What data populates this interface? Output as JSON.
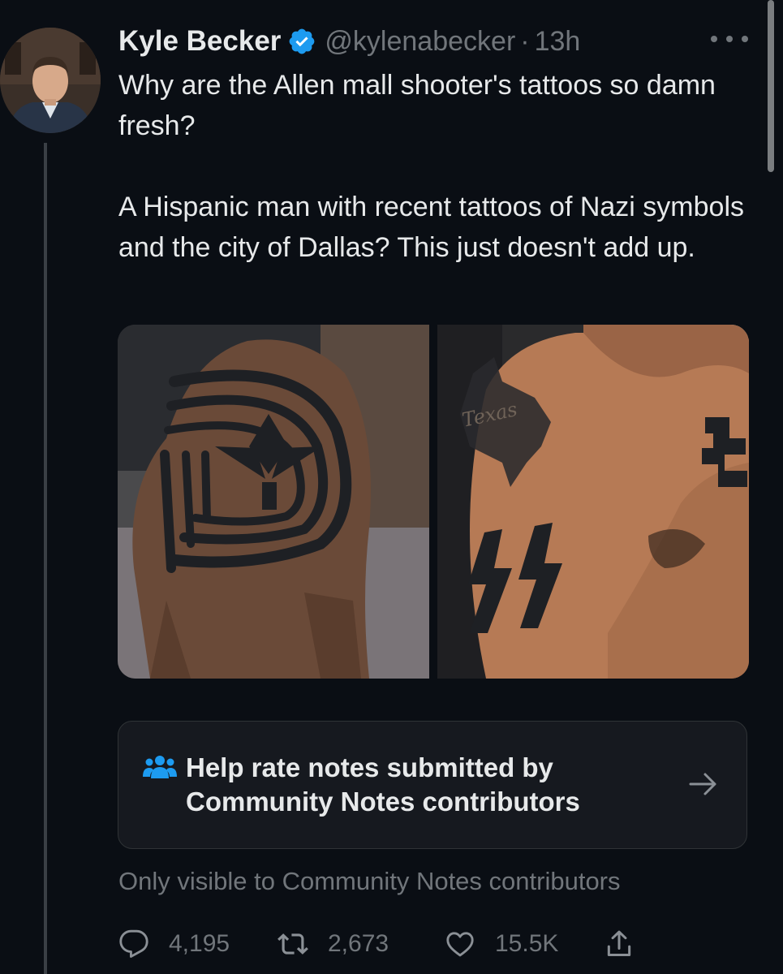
{
  "author": {
    "name": "Kyle Becker",
    "handle": "@kylenabecker",
    "separator": "·",
    "time": "13h"
  },
  "tweet": {
    "paragraphs": [
      "Why are the Allen mall shooter's tattoos so damn fresh?",
      "A Hispanic man with recent tattoos of Nazi symbols and the city of Dallas? This just doesn't add up."
    ]
  },
  "media": {
    "count": 2,
    "tattoo_lettering": "Texas"
  },
  "community_notes": {
    "prompt": "Help rate notes submitted by Community Notes contributors",
    "visibility": "Only visible to Community Notes contributors"
  },
  "metrics": {
    "replies": "4,195",
    "retweets": "2,673",
    "likes": "15.5K"
  },
  "colors": {
    "background": "#0a0e14",
    "text": "#e7e9ea",
    "muted": "#71767b",
    "verified": "#1d9bf0",
    "card": "#16191f"
  },
  "icons": {
    "verified": "verified-badge-icon",
    "more": "more-options-icon",
    "notes": "people-icon",
    "arrow": "arrow-right-icon",
    "reply": "reply-icon",
    "retweet": "retweet-icon",
    "like": "heart-icon",
    "share": "share-icon"
  }
}
